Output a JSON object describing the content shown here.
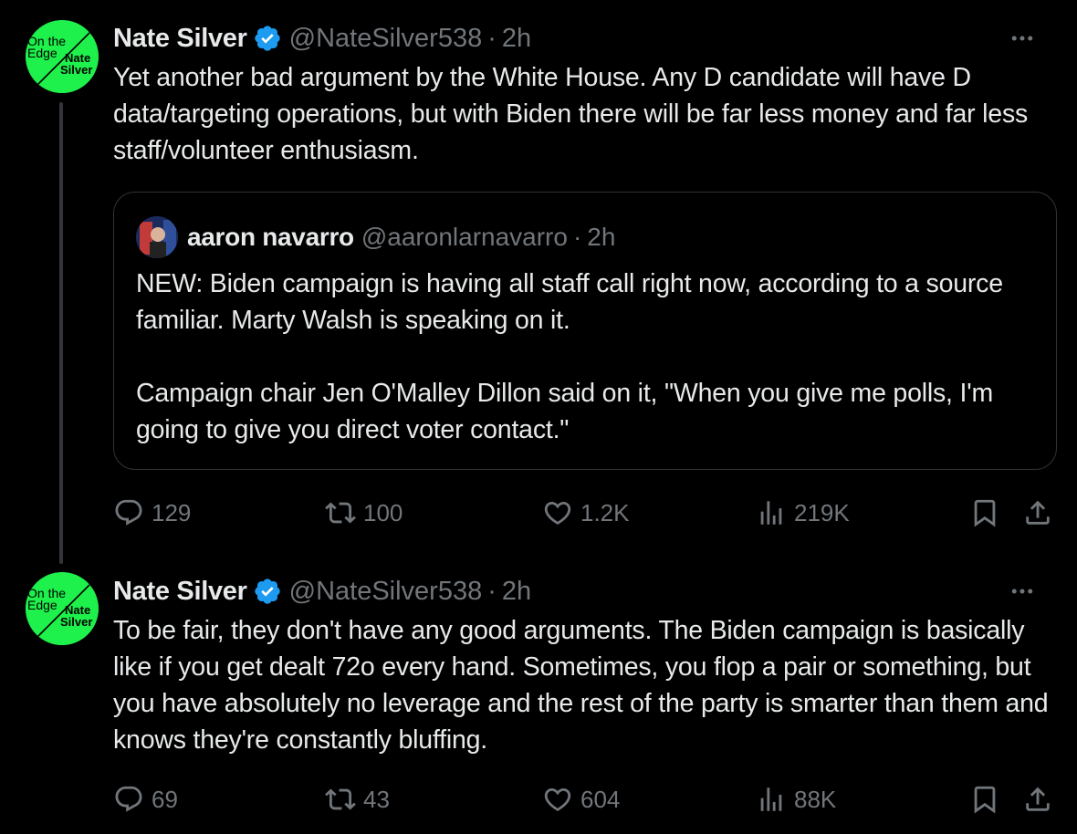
{
  "tweets": [
    {
      "author": {
        "name": "Nate Silver",
        "handle": "@NateSilver538",
        "avatar_text": [
          "On the",
          "Edge",
          "Nate",
          "Silver"
        ]
      },
      "separator": "·",
      "time": "2h",
      "text": "Yet another bad argument by the White House. Any D candidate will have D data/targeting operations, but with Biden there will be far less money and far less staff/volunteer enthusiasm.",
      "quote": {
        "author_name": "aaron navarro",
        "author_handle": "@aaronlarnavarro",
        "separator": "·",
        "time": "2h",
        "text": "NEW: Biden campaign is having all staff call right now, according to a source familiar. Marty Walsh is speaking on it.\n\nCampaign chair Jen O'Malley Dillon said on it, \"When you give me polls, I'm going to give you direct voter contact.\""
      },
      "stats": {
        "replies": "129",
        "reposts": "100",
        "likes": "1.2K",
        "views": "219K"
      }
    },
    {
      "author": {
        "name": "Nate Silver",
        "handle": "@NateSilver538",
        "avatar_text": [
          "On the",
          "Edge",
          "Nate",
          "Silver"
        ]
      },
      "separator": "·",
      "time": "2h",
      "text": "To be fair, they don't have any good arguments. The Biden campaign is basically like if you get dealt 72o every hand. Sometimes, you flop a pair or something, but you have absolutely no leverage and the rest of the party is smarter than them and knows they're constantly bluffing.",
      "stats": {
        "replies": "69",
        "reposts": "43",
        "likes": "604",
        "views": "88K"
      }
    }
  ],
  "colors": {
    "background": "#000000",
    "text": "#e7e9ea",
    "muted": "#71767b",
    "verified": "#1d9bf0",
    "avatar_green": "#1ef04c"
  },
  "icons": [
    "verified-badge-icon",
    "more-icon",
    "reply-icon",
    "repost-icon",
    "like-icon",
    "views-icon",
    "bookmark-icon",
    "share-icon"
  ]
}
